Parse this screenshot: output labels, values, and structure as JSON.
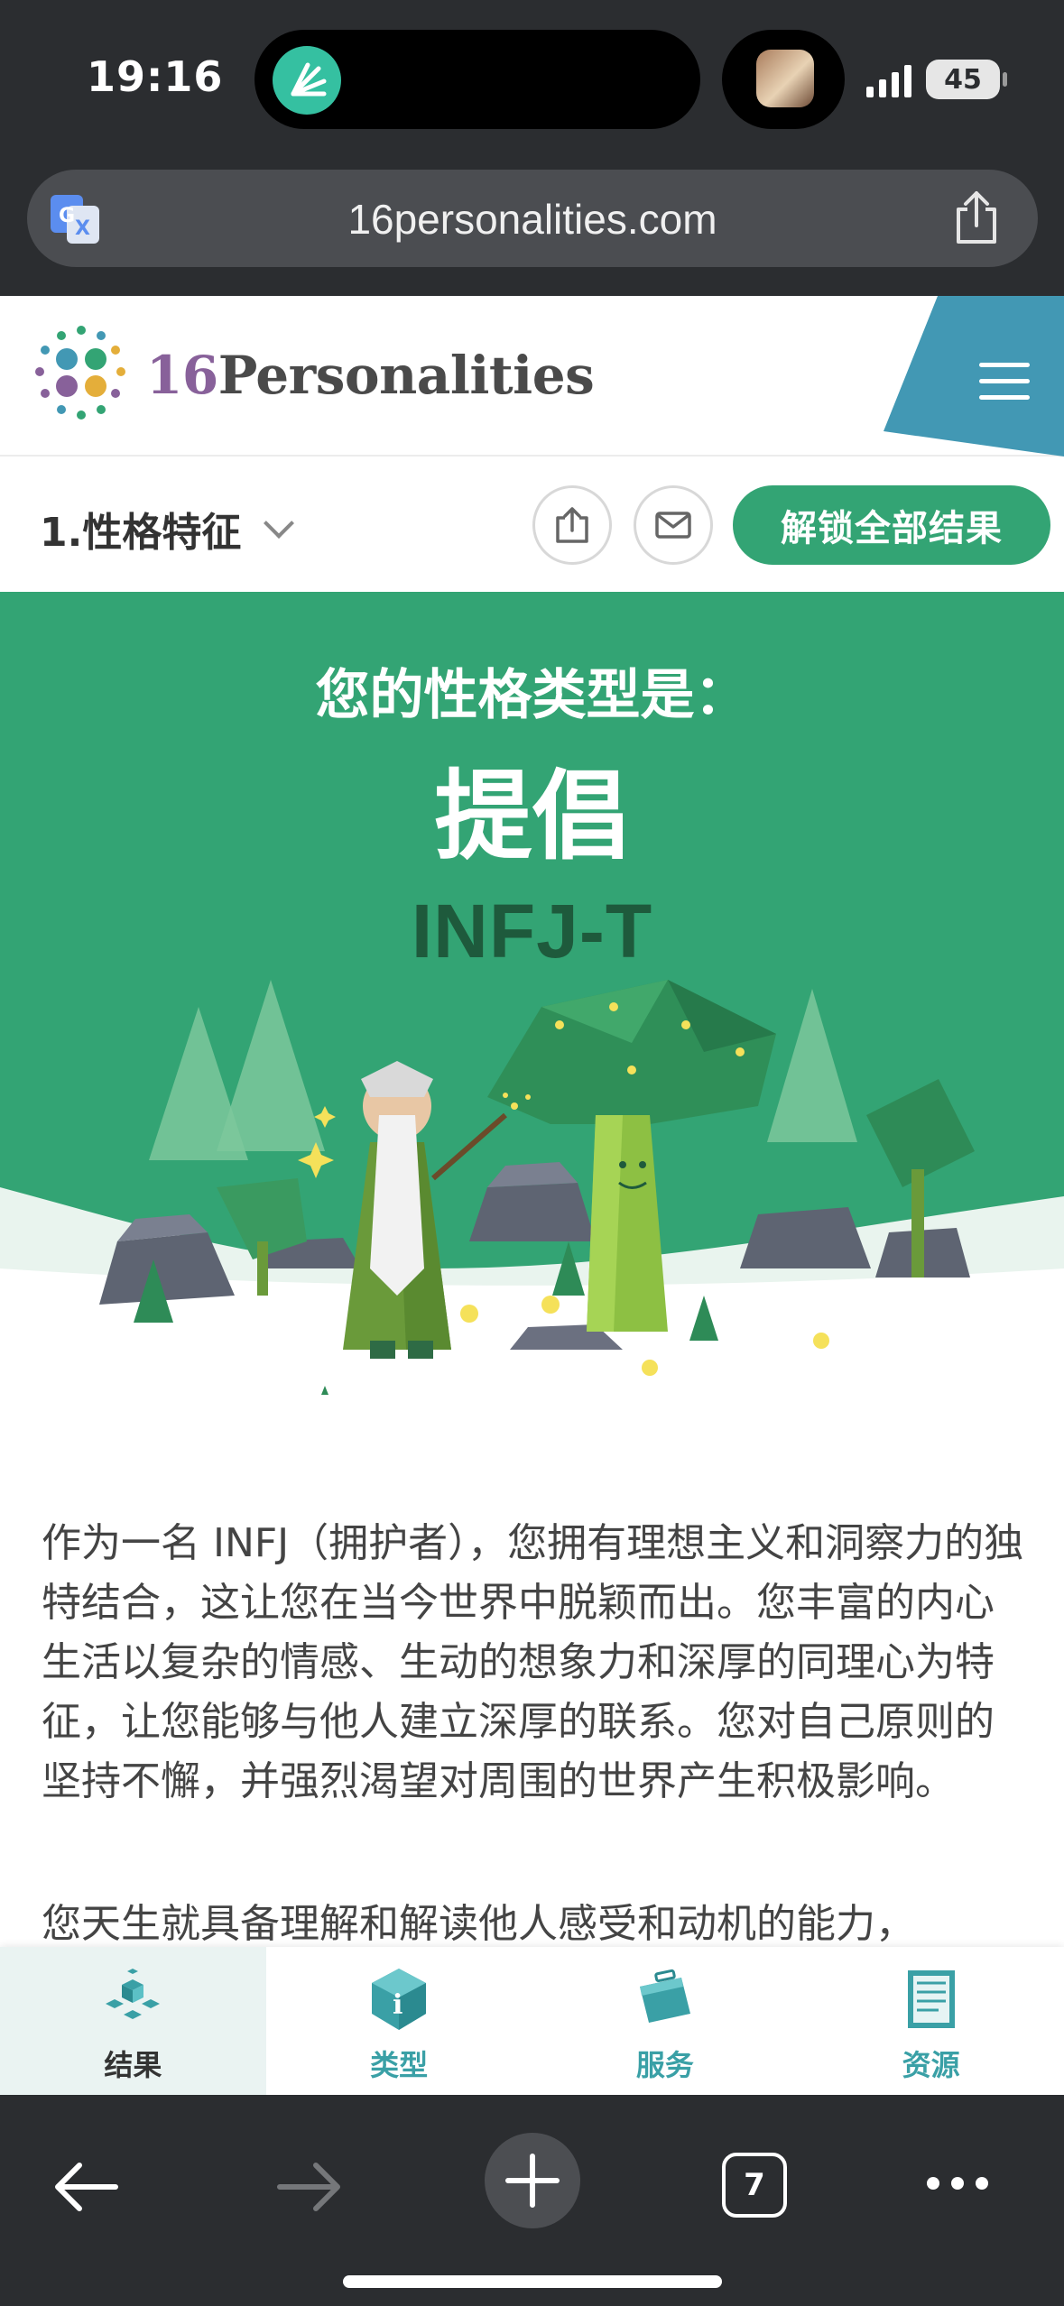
{
  "status_bar": {
    "time": "19:16",
    "battery": "45"
  },
  "browser": {
    "url": "16personalities.com",
    "tab_count": "7",
    "icons": [
      "translate-icon",
      "share-icon",
      "back-arrow-icon",
      "forward-arrow-icon",
      "new-tab-plus-icon",
      "tabs-icon",
      "more-icon"
    ]
  },
  "site": {
    "logo_number": "16",
    "logo_word": "Personalities"
  },
  "subnav": {
    "section": "1.性格特征",
    "unlock_label": "解锁全部结果"
  },
  "hero": {
    "subtitle": "您的性格类型是：",
    "title": "提倡",
    "code": "INFJ-T"
  },
  "article": {
    "paragraph1": "作为一名 INFJ（拥护者），您拥有理想主义和洞察力的独特结合，这让您在当今世界中脱颖而出。您丰富的内心生活以复杂的情感、生动的想象力和深厚的同理心为特征，让您能够与他人建立深厚的联系。您对自己原则的坚持不懈，并强烈渴望对周围的世界产生积极影响。",
    "paragraph2": "您天生就具备理解和解读他人感受和动机的能力，"
  },
  "tabbar": {
    "tabs": [
      {
        "label": "结果",
        "active": true
      },
      {
        "label": "类型",
        "active": false
      },
      {
        "label": "服务",
        "active": false
      },
      {
        "label": "资源",
        "active": false
      }
    ]
  },
  "colors": {
    "brand_green": "#33a474",
    "dark_green": "#1e5a3c",
    "menu_blue": "#4298b4",
    "chrome": "#2b2d30"
  }
}
